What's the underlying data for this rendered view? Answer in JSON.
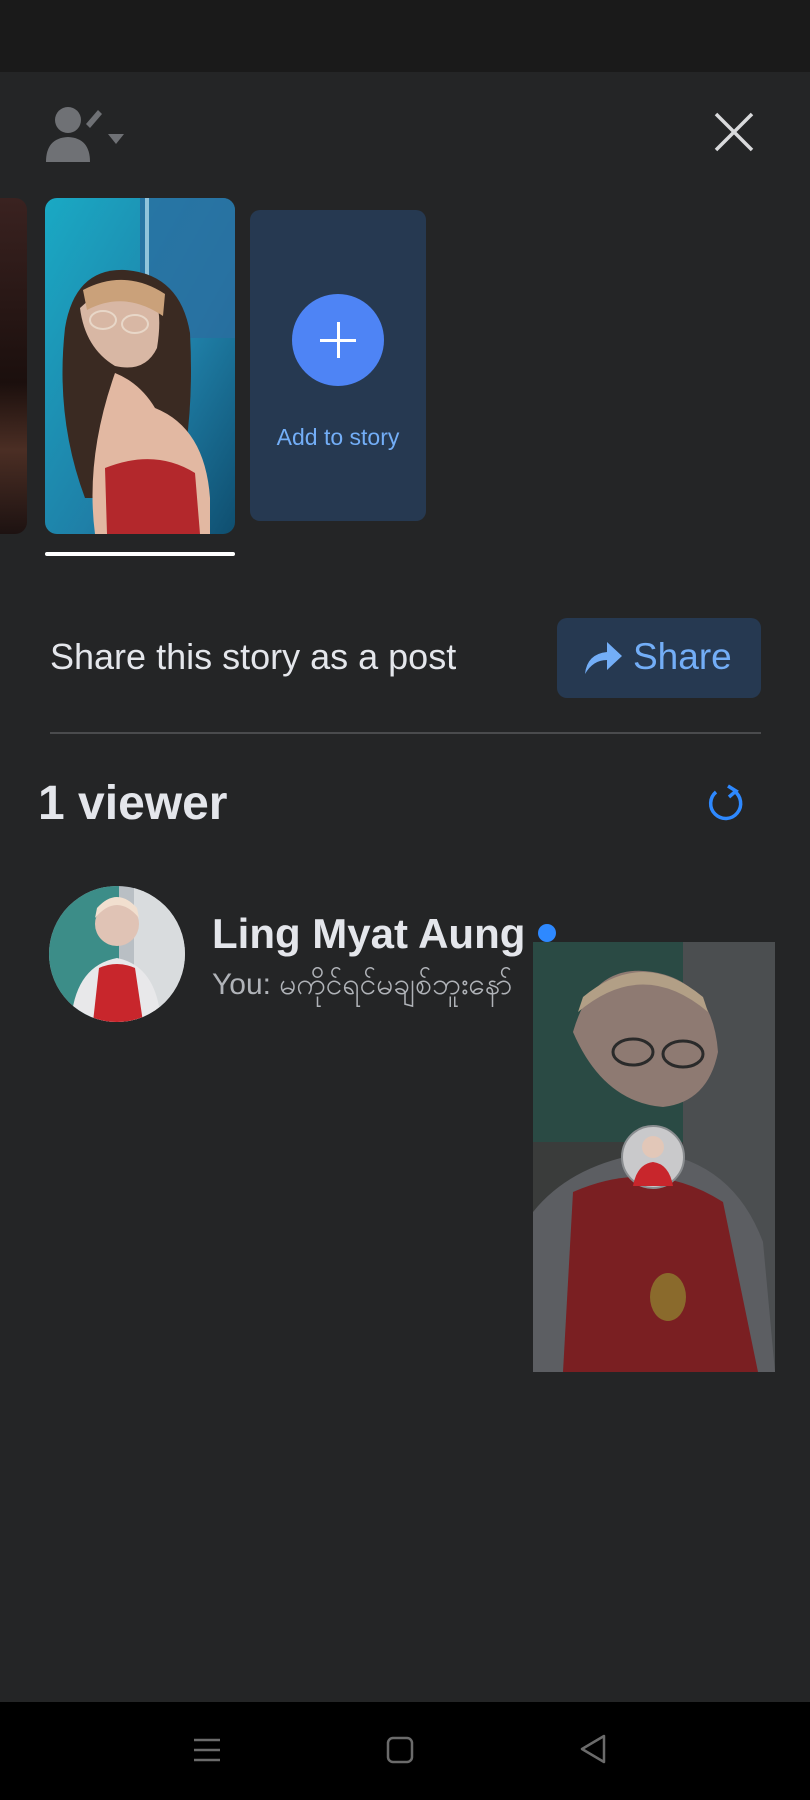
{
  "header": {
    "privacy_icon": "person-privacy-icon",
    "close_icon": "close-icon"
  },
  "story_tray": {
    "add_to_story_label": "Add to story",
    "add_icon": "plus-icon"
  },
  "share_row": {
    "text": "Share this story as a post",
    "button_label": "Share",
    "button_icon": "share-arrow-icon"
  },
  "viewers": {
    "title": "1 viewer",
    "refresh_icon": "refresh-icon",
    "list": [
      {
        "name": "Ling Myat Aung",
        "message": "You: မကိုင်ရင်မချစ်ဘူးနော်",
        "online": true
      }
    ]
  },
  "nav_bar": {
    "icons": [
      "menu-icon",
      "home-square-icon",
      "back-triangle-icon"
    ]
  },
  "colors": {
    "background": "#242526",
    "accent": "#4e84f5",
    "link": "#73aef7",
    "card": "#263951",
    "online": "#2e89ff"
  }
}
